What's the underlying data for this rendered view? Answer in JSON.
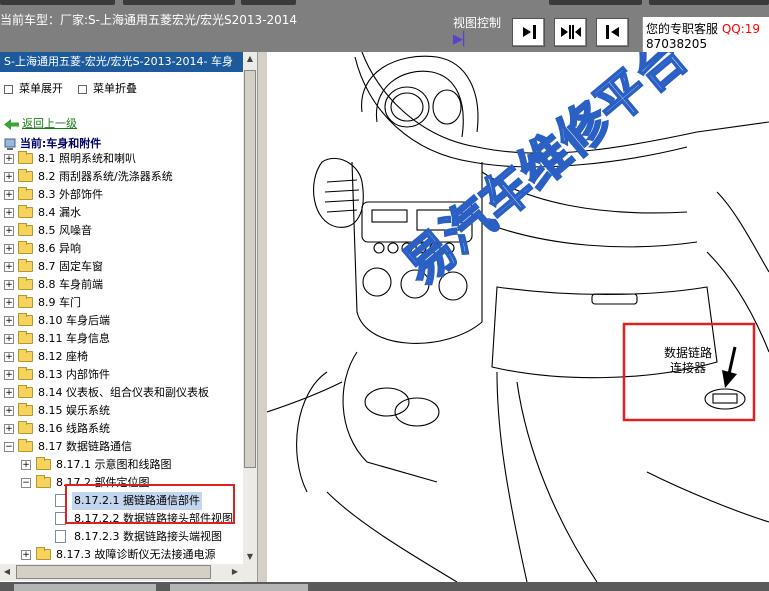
{
  "header": {
    "title": "当前车型：厂家:S-上海通用五菱宏光/宏光S2013-2014",
    "view_control_label": "视图控制",
    "service_label": "您的专职客服",
    "qq_label": "QQ:19",
    "phone": "87038205"
  },
  "sidebar": {
    "header": "S-上海通用五菱-宏光/宏光S-2013-2014- 车身",
    "expand_menu": "菜单展开",
    "collapse_menu": "菜单折叠",
    "back": "返回上一级",
    "current": "当前:车身和附件",
    "items": [
      {
        "label": "8.1 照明系统和喇叭"
      },
      {
        "label": "8.2 雨刮器系统/洗涤器系统"
      },
      {
        "label": "8.3 外部饰件"
      },
      {
        "label": "8.4 漏水"
      },
      {
        "label": "8.5 风噪音"
      },
      {
        "label": "8.6 异响"
      },
      {
        "label": "8.7 固定车窗"
      },
      {
        "label": "8.8 车身前端"
      },
      {
        "label": "8.9 车门"
      },
      {
        "label": "8.10 车身后端"
      },
      {
        "label": "8.11 车身信息"
      },
      {
        "label": "8.12 座椅"
      },
      {
        "label": "8.13 内部饰件"
      },
      {
        "label": "8.14 仪表板、组合仪表和副仪表板"
      },
      {
        "label": "8.15 娱乐系统"
      },
      {
        "label": "8.16 线路系统"
      },
      {
        "label": "8.17 数据链路通信"
      },
      {
        "label": "8.17.1 示意图和线路图"
      },
      {
        "label": "8.17.2 部件定位图"
      },
      {
        "label": "8.17.2.1 据链路通信部件"
      },
      {
        "label": "8.17.2.2 数据链路接头部件视图"
      },
      {
        "label": "8.17.2.3 数据链路接头端视图"
      },
      {
        "label": "8.17.3 故障诊断仪无法接通电源"
      }
    ]
  },
  "diagram": {
    "callout": [
      "数据链路",
      "连接器"
    ],
    "watermark": "易汽车维修平台"
  },
  "colors": {
    "header_bg": "#1c5a9c",
    "highlight": "#e02020",
    "watermark": "#2a5fc4",
    "qq": "#ff0000"
  }
}
